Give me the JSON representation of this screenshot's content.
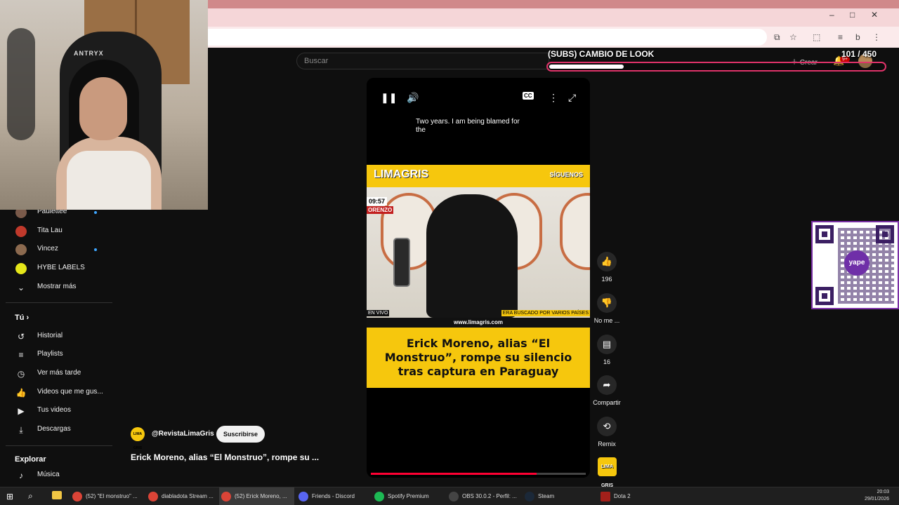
{
  "webcam": {
    "brand": "ANTRYX"
  },
  "browser": {
    "window_controls": {
      "minimize": "–",
      "maximize": "□",
      "close": "✕"
    },
    "tools": [
      "⧉",
      "☆",
      "⬚",
      "≡",
      "b",
      "⋮"
    ]
  },
  "yt_header": {
    "search_placeholder": "Buscar",
    "create_label": "Crear",
    "notification_badge": "9+"
  },
  "subs_goal": {
    "title": "(SUBS) CAMBIO DE LOOK",
    "count": "101 / 450",
    "progress": 0.2244
  },
  "sidebar": {
    "subscriptions": [
      {
        "label": "Paulettee",
        "color": "#7a5a4a",
        "new": true
      },
      {
        "label": "Tita Lau",
        "color": "#c0392b",
        "new": false
      },
      {
        "label": "Vincez",
        "color": "#8c6a4f",
        "new": true
      },
      {
        "label": "HYBE LABELS",
        "color": "#e5e619",
        "new": false
      }
    ],
    "show_more": "Mostrar más",
    "you_heading": "Tú",
    "you_items": [
      {
        "label": "Historial",
        "icon": "history-icon",
        "glyph": "↺"
      },
      {
        "label": "Playlists",
        "icon": "playlist-icon",
        "glyph": "≡"
      },
      {
        "label": "Ver más tarde",
        "icon": "clock-icon",
        "glyph": "◷"
      },
      {
        "label": "Videos que me gus...",
        "icon": "thumbs-up-icon",
        "glyph": "👍"
      },
      {
        "label": "Tus videos",
        "icon": "video-icon",
        "glyph": "▶"
      },
      {
        "label": "Descargas",
        "icon": "download-icon",
        "glyph": "⤓"
      }
    ],
    "explore_heading": "Explorar",
    "explore_items": [
      {
        "label": "Música",
        "icon": "music-icon",
        "glyph": "♪"
      }
    ]
  },
  "player": {
    "caption": "Two years.   I am being blamed for the",
    "cc_label": "CC",
    "progress": 0.77,
    "video": {
      "logo": "LIMAGRIS",
      "follow": "SÍGUENOS",
      "time": "09:57",
      "place": "ORENZO",
      "live": "EN VIVO",
      "ticker": "ERA BUSCADO POR VARIOS PAÍSES",
      "url": "www.limagris.com",
      "headline": "Erick Moreno, alias “El Monstruo”, rompe su silencio tras captura en Paraguay"
    }
  },
  "actions": {
    "like_count": "196",
    "dislike_label": "No me ...",
    "comment_count": "16",
    "share_label": "Compartir",
    "remix_label": "Remix",
    "channel_thumb": "LIMA GRIS"
  },
  "short_info": {
    "channel_avatar": "LIMA GRIS",
    "channel": "@RevistaLimaGris",
    "subscribe": "Suscribirse",
    "title": "Erick Moreno, alias “El Monstruo”, rompe su ..."
  },
  "qr": {
    "label": "yape"
  },
  "taskbar": {
    "apps": [
      {
        "label": "(52) \"El monstruo\" ...",
        "color": "#db4437",
        "active": false
      },
      {
        "label": "diabladota Stream ...",
        "color": "#db4437",
        "active": false
      },
      {
        "label": "(52) Erick Moreno, ...",
        "color": "#db4437",
        "active": true
      },
      {
        "label": "Friends - Discord",
        "color": "#5865f2",
        "active": false
      },
      {
        "label": "Spotify Premium",
        "color": "#1db954",
        "active": false
      },
      {
        "label": "OBS 30.0.2 - Perfil: ...",
        "color": "#444",
        "active": false
      },
      {
        "label": "Steam",
        "color": "#1b2838",
        "active": false
      },
      {
        "label": "Dota 2",
        "color": "#a3201a",
        "active": false
      }
    ],
    "time": "20:03",
    "date": "29/01/2026"
  }
}
